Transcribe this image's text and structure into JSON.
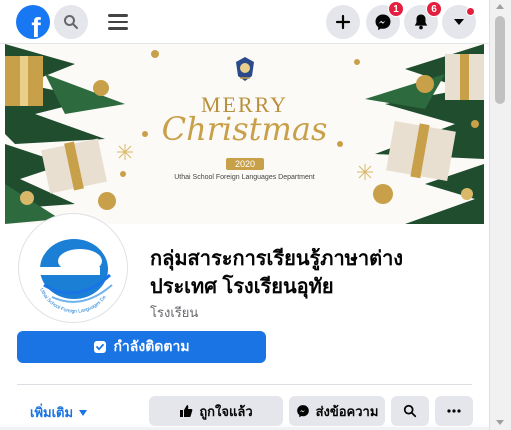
{
  "topbar": {
    "logo_letter": "f",
    "messenger_badge": "1",
    "notifications_badge": "6"
  },
  "cover": {
    "merry": "MERRY",
    "christmas": "Christmas",
    "year": "2020",
    "caption": "Uthai School Foreign Languages Department"
  },
  "profile_logo_text": "Uthai School Foreign Languages Department",
  "page": {
    "name_line1": "กลุ่มสาระการเรียนรู้ภาษาต่าง",
    "name_line2": "ประเทศ โรงเรียนอุทัย",
    "category": "โรงเรียน"
  },
  "actions": {
    "following_label": "กำลังติดตาม",
    "more_label": "เพิ่มเติม",
    "like_label": "ถูกใจแล้ว",
    "message_label": "ส่งข้อความ"
  },
  "colors": {
    "brand_blue": "#1877f2",
    "button_blue": "#1b74e4",
    "badge_red": "#e41e3f",
    "gold": "#c9a04a"
  },
  "icons": [
    "facebook-logo",
    "search-icon",
    "menu-icon",
    "plus-icon",
    "messenger-icon",
    "bell-icon",
    "caret-down-icon",
    "following-check-icon",
    "thumbs-up-icon",
    "search-icon",
    "more-dots-icon"
  ]
}
